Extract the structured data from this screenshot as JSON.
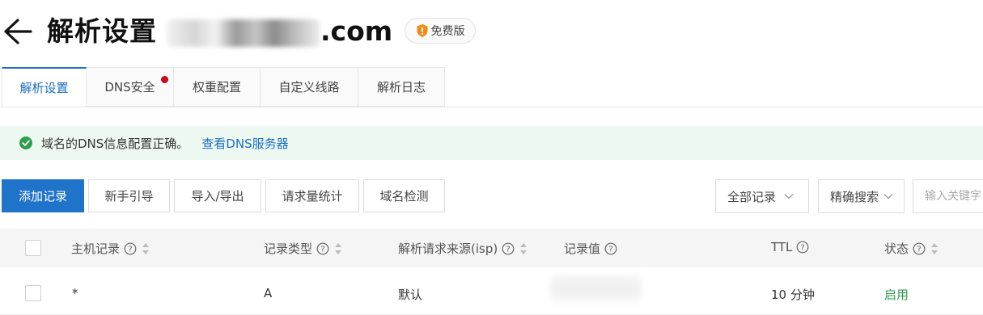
{
  "header": {
    "title": "解析设置",
    "domain_suffix": ".com",
    "edition_badge": "免费版"
  },
  "tabs": [
    {
      "label": "解析设置",
      "active": true,
      "has_dot": false
    },
    {
      "label": "DNS安全",
      "active": false,
      "has_dot": true
    },
    {
      "label": "权重配置",
      "active": false,
      "has_dot": false
    },
    {
      "label": "自定义线路",
      "active": false,
      "has_dot": false
    },
    {
      "label": "解析日志",
      "active": false,
      "has_dot": false
    }
  ],
  "alert": {
    "message": "域名的DNS信息配置正确。",
    "link": "查看DNS服务器",
    "color": "#2e9d4d"
  },
  "toolbar": {
    "add_record": "添加记录",
    "guide": "新手引导",
    "import_export": "导入/导出",
    "request_stats": "请求量统计",
    "domain_check": "域名检测",
    "record_filter": "全部记录",
    "search_mode": "精确搜索",
    "search_placeholder": "输入关键字"
  },
  "table": {
    "columns": {
      "host": "主机记录",
      "type": "记录类型",
      "isp": "解析请求来源(isp)",
      "value": "记录值",
      "ttl": "TTL",
      "status": "状态"
    },
    "rows": [
      {
        "host": "*",
        "type": "A",
        "isp": "默认",
        "value": "",
        "ttl": "10 分钟",
        "status": "启用"
      }
    ]
  },
  "colors": {
    "accent": "#1a6fc5",
    "primary_button": "#1f73c8",
    "alert_bg": "#edf9f0",
    "tab_dot": "#d0021b",
    "status_enabled": "#2e9d4d"
  }
}
